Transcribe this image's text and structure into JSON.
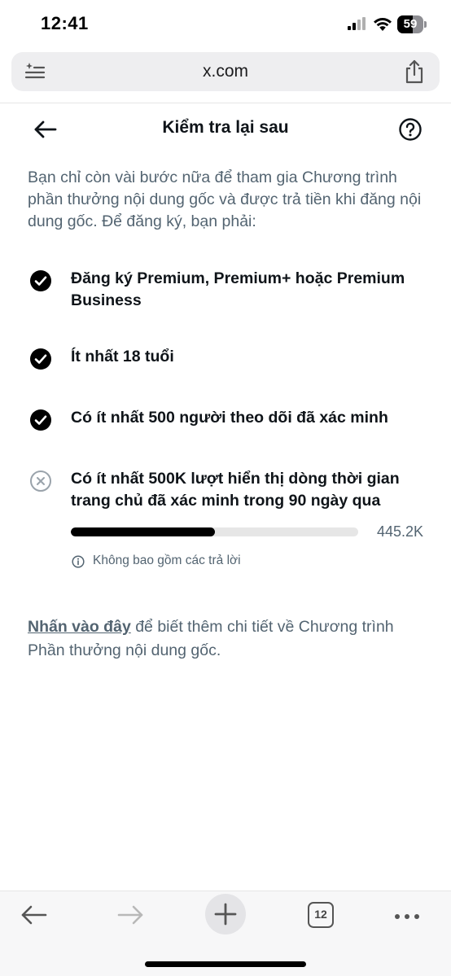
{
  "status_bar": {
    "time": "12:41",
    "battery_level": "59",
    "icons": [
      "signal-icon",
      "wifi-icon",
      "battery-icon"
    ]
  },
  "browser": {
    "url": "x.com",
    "icons": [
      "reader-icon",
      "share-icon"
    ]
  },
  "header": {
    "title": "Kiểm tra lại sau",
    "icons": [
      "back-arrow-icon",
      "help-icon"
    ]
  },
  "intro": "Bạn chỉ còn vài bước nữa để tham gia Chương trình phần thưởng nội dung gốc và được trả tiền khi đăng nội dung gốc. Để đăng ký, bạn phải:",
  "requirements": [
    {
      "label": "Đăng ký Premium, Premium+ hoặc Premium Business",
      "status": "done"
    },
    {
      "label": "Ít nhất 18 tuổi",
      "status": "done"
    },
    {
      "label": "Có ít nhất 500 người theo dõi đã xác minh",
      "status": "done"
    },
    {
      "label": "Có ít nhất 500K lượt hiển thị dòng thời gian trang chủ đã xác minh trong 90 ngày qua",
      "status": "not-done"
    }
  ],
  "progress": {
    "value_label": "445.2K",
    "fraction": 0.5,
    "note": "Không bao gồm các trả lời"
  },
  "footer": {
    "link_text": "Nhấn vào đây",
    "rest_text": " để biết thêm chi tiết về Chương trình Phần thưởng nội dung gốc."
  },
  "toolbar": {
    "tab_count": "12",
    "icons": [
      "back-icon",
      "forward-icon",
      "new-tab-icon",
      "tabs-icon",
      "more-icon"
    ]
  },
  "colors": {
    "text_primary": "#0f1419",
    "text_secondary": "#536471",
    "check_fill": "#000000",
    "progress_track": "#e6e6e6",
    "progress_fill": "#000000"
  }
}
